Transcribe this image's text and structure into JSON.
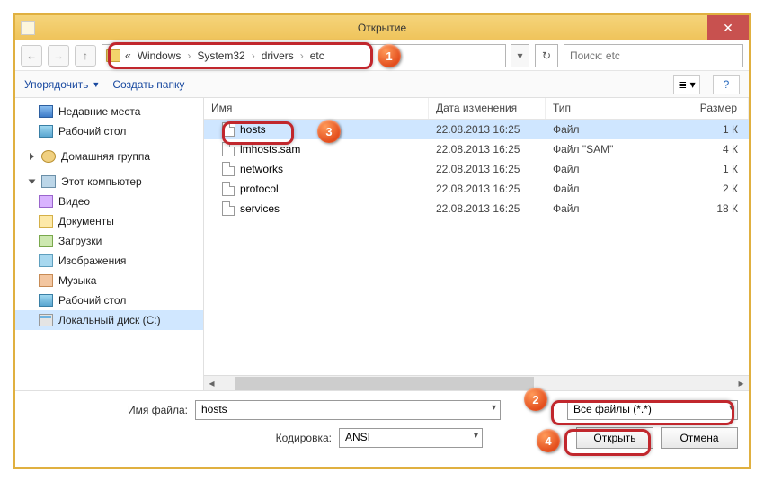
{
  "titlebar": {
    "title": "Открытие"
  },
  "nav": {
    "breadcrumb_prefix": "«",
    "crumbs": [
      "Windows",
      "System32",
      "drivers",
      "etc"
    ],
    "search_placeholder": "Поиск: etc"
  },
  "toolbar": {
    "organize": "Упорядочить",
    "new_folder": "Создать папку"
  },
  "tree": {
    "recent": "Недавние места",
    "desktop": "Рабочий стол",
    "homegroup": "Домашняя группа",
    "this_pc": "Этот компьютер",
    "videos": "Видео",
    "documents": "Документы",
    "downloads": "Загрузки",
    "pictures": "Изображения",
    "music": "Музыка",
    "desktop2": "Рабочий стол",
    "local_disk": "Локальный диск (C:)"
  },
  "columns": {
    "name": "Имя",
    "date": "Дата изменения",
    "type": "Тип",
    "size": "Размер"
  },
  "files": [
    {
      "name": "hosts",
      "date": "22.08.2013 16:25",
      "type": "Файл",
      "size": "1 К"
    },
    {
      "name": "lmhosts.sam",
      "date": "22.08.2013 16:25",
      "type": "Файл \"SAM\"",
      "size": "4 К"
    },
    {
      "name": "networks",
      "date": "22.08.2013 16:25",
      "type": "Файл",
      "size": "1 К"
    },
    {
      "name": "protocol",
      "date": "22.08.2013 16:25",
      "type": "Файл",
      "size": "2 К"
    },
    {
      "name": "services",
      "date": "22.08.2013 16:25",
      "type": "Файл",
      "size": "18 К"
    }
  ],
  "bottom": {
    "filename_label": "Имя файла:",
    "filename_value": "hosts",
    "filter_value": "Все файлы  (*.*)",
    "encoding_label": "Кодировка:",
    "encoding_value": "ANSI",
    "open": "Открыть",
    "cancel": "Отмена"
  },
  "badges": {
    "b1": "1",
    "b2": "2",
    "b3": "3",
    "b4": "4"
  }
}
